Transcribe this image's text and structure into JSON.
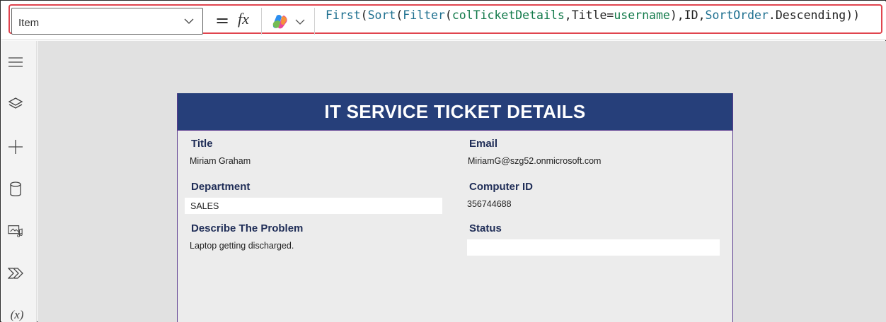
{
  "formula_bar": {
    "property": "Item",
    "equals": "=",
    "fx": "fx",
    "formula_parts": [
      {
        "t": "First",
        "c": "kw"
      },
      {
        "t": "(",
        "c": "plain"
      },
      {
        "t": "Sort",
        "c": "kw"
      },
      {
        "t": "(",
        "c": "plain"
      },
      {
        "t": "Filter",
        "c": "kw"
      },
      {
        "t": "(",
        "c": "plain"
      },
      {
        "t": "colTicketDetails",
        "c": "id"
      },
      {
        "t": ",",
        "c": "plain"
      },
      {
        "t": "Title",
        "c": "plain"
      },
      {
        "t": "=",
        "c": "plain"
      },
      {
        "t": "username",
        "c": "id"
      },
      {
        "t": "),",
        "c": "plain"
      },
      {
        "t": "ID",
        "c": "plain"
      },
      {
        "t": ",",
        "c": "plain"
      },
      {
        "t": "SortOrder",
        "c": "kw"
      },
      {
        "t": ".",
        "c": "plain"
      },
      {
        "t": "Descending",
        "c": "plain"
      },
      {
        "t": "))",
        "c": "plain"
      }
    ]
  },
  "left_rail": {
    "items": [
      {
        "icon": "hamburger-menu-icon"
      },
      {
        "icon": "layers-icon"
      },
      {
        "icon": "insert-plus-icon"
      },
      {
        "icon": "data-cylinder-icon"
      },
      {
        "icon": "media-icon"
      },
      {
        "icon": "power-automate-icon"
      },
      {
        "icon": "variables-icon",
        "text": "(x)"
      }
    ]
  },
  "form": {
    "title": "IT SERVICE TICKET DETAILS",
    "fields": {
      "title_label": "Title",
      "title_value": "Miriam Graham",
      "email_label": "Email",
      "email_value": "MiriamG@szg52.onmicrosoft.com",
      "department_label": "Department",
      "department_value": "SALES",
      "computer_id_label": "Computer ID",
      "computer_id_value": "356744688",
      "problem_label": "Describe The Problem",
      "problem_value": "Laptop getting discharged.",
      "status_label": "Status",
      "status_value": ""
    }
  },
  "colors": {
    "highlight": "#e0444e",
    "form_header": "#263f7a",
    "label": "#1f2d57"
  }
}
